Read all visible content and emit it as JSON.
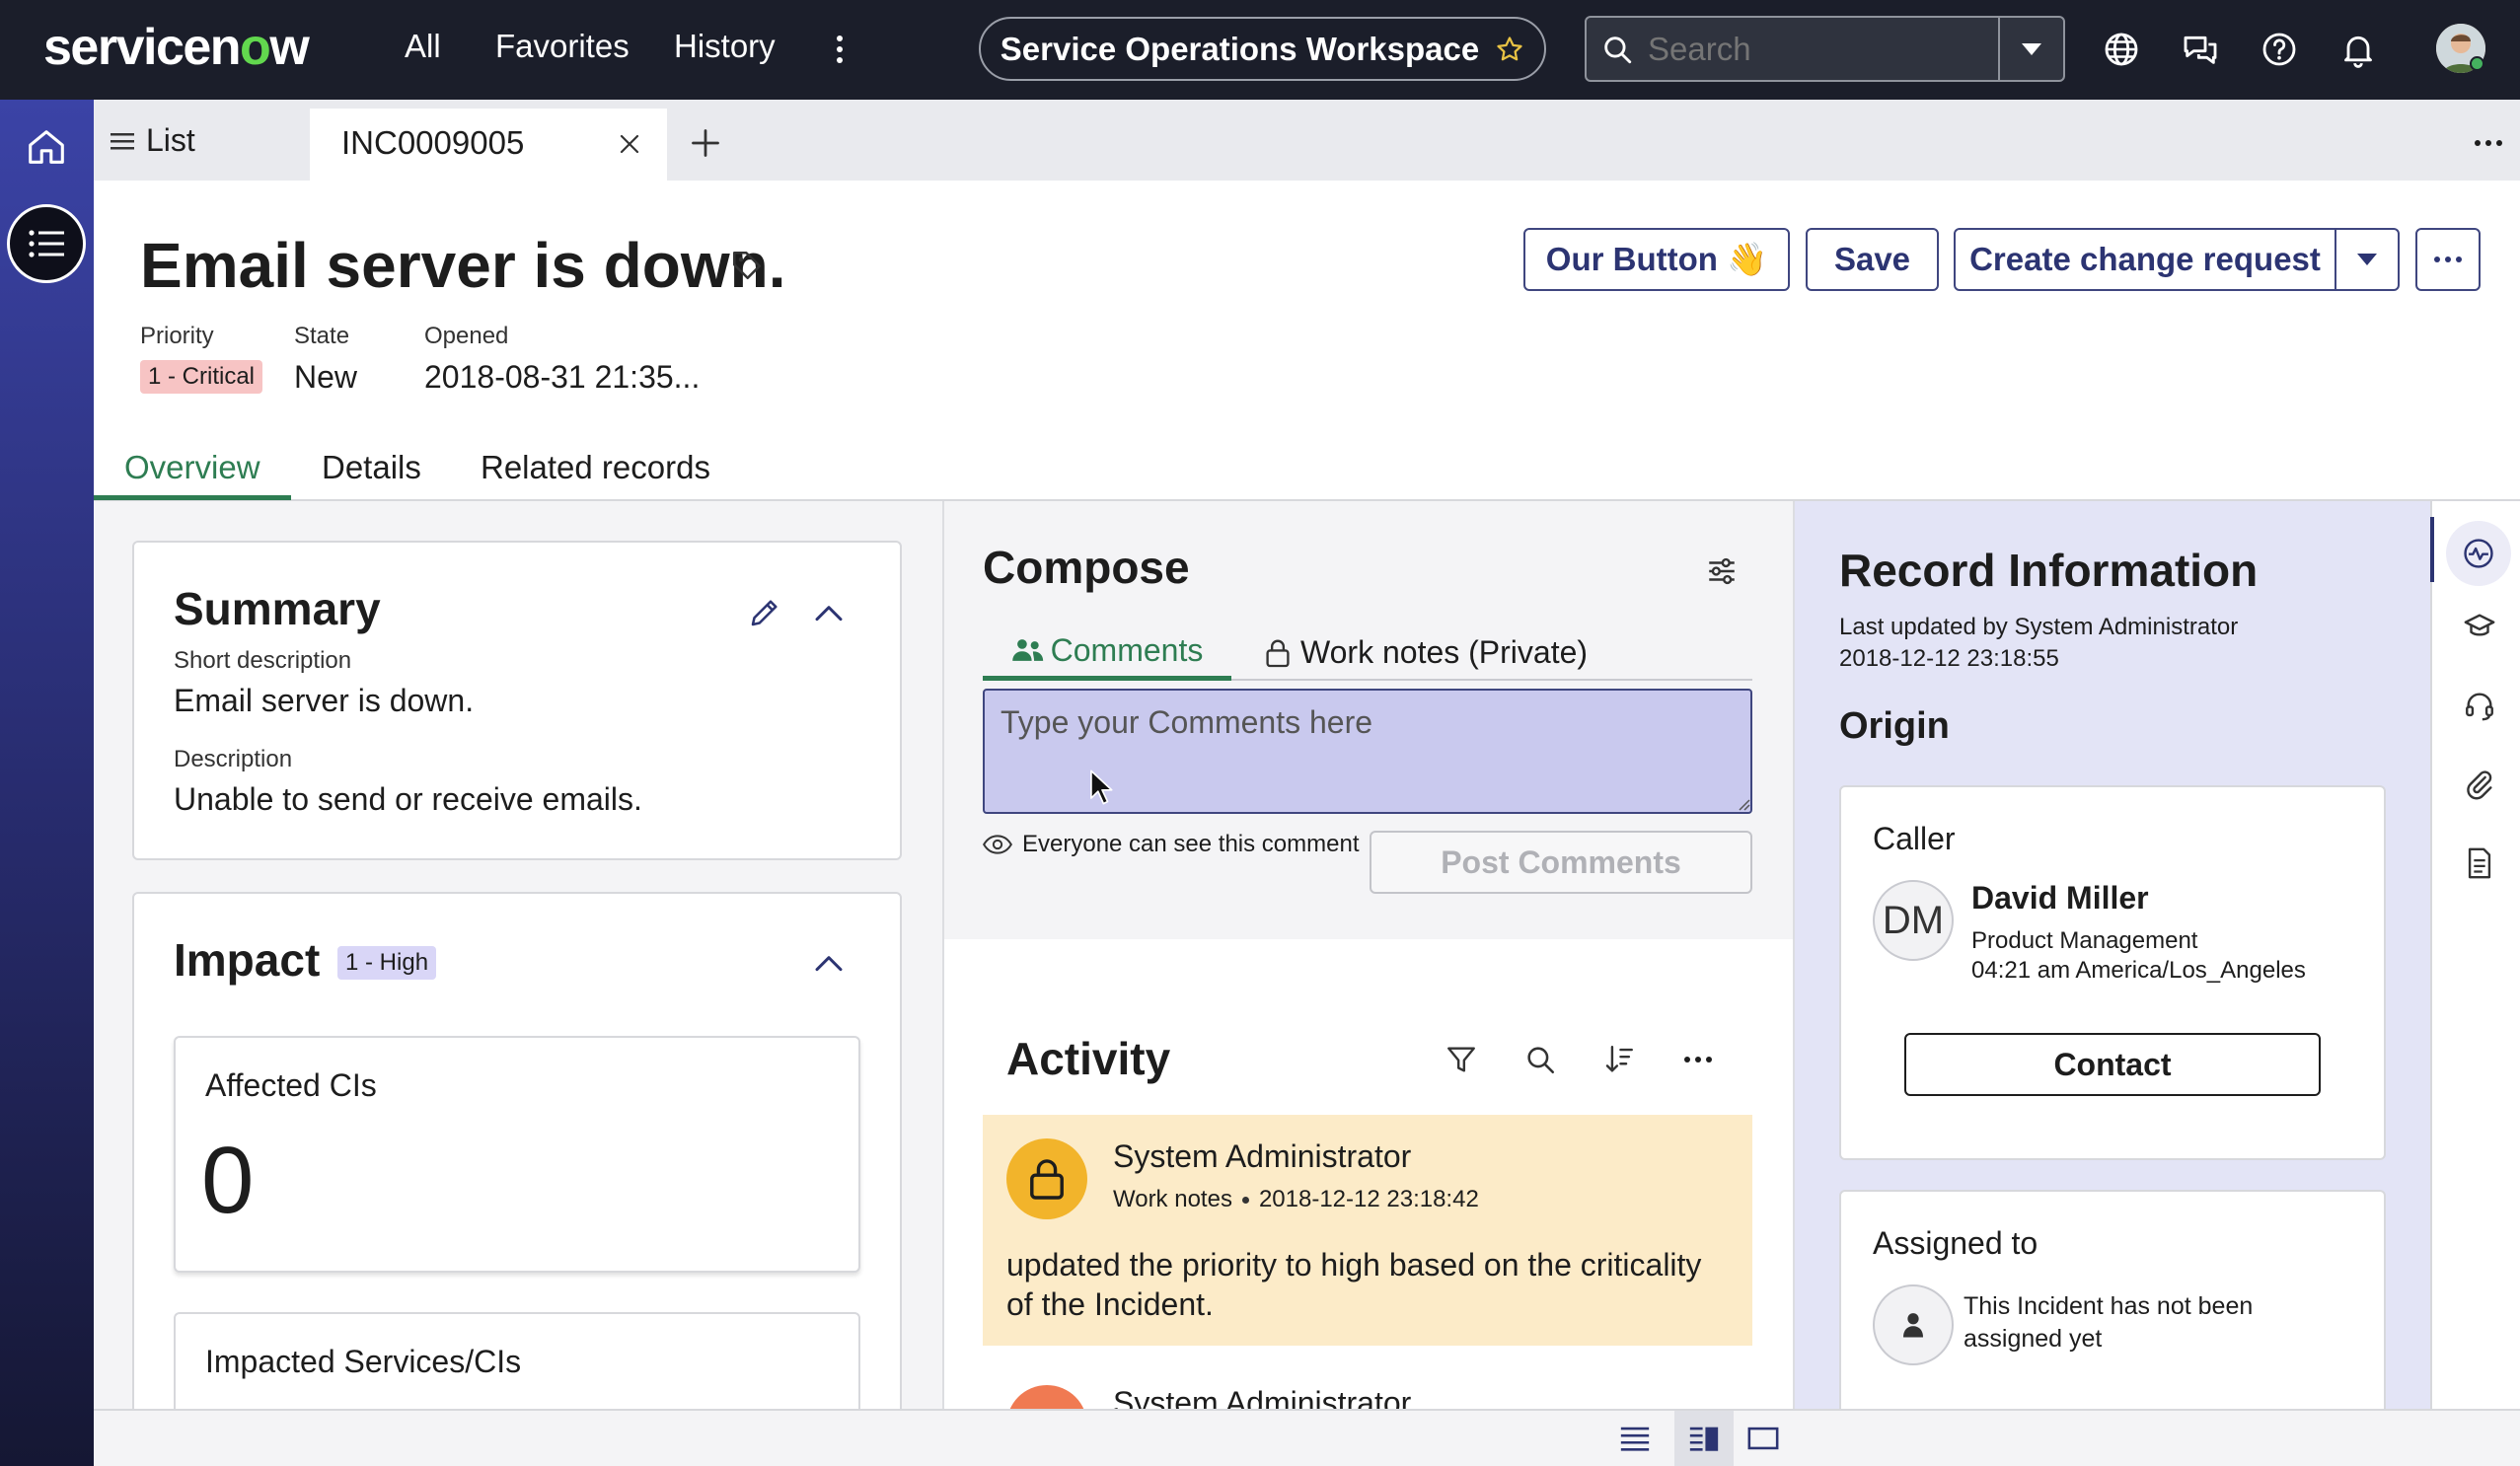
{
  "topbar": {
    "logo_text_a": "servicen",
    "logo_text_o": "o",
    "logo_text_b": "w",
    "nav": [
      "All",
      "Favorites",
      "History"
    ],
    "workspace": "Service Operations Workspace",
    "search_placeholder": "Search"
  },
  "tabs": {
    "list_label": "List",
    "record_label": "INC0009005"
  },
  "record": {
    "title": "Email server is down.",
    "priority_label": "Priority",
    "priority_value": "1 - Critical",
    "state_label": "State",
    "state_value": "New",
    "opened_label": "Opened",
    "opened_value": "2018-08-31 21:35..."
  },
  "header_buttons": {
    "our_button": "Our Button 👋",
    "save": "Save",
    "create_change": "Create change request"
  },
  "record_tabs": [
    "Overview",
    "Details",
    "Related records"
  ],
  "summary": {
    "title": "Summary",
    "short_desc_label": "Short description",
    "short_desc_value": "Email server is down.",
    "desc_label": "Description",
    "desc_value": "Unable to send or receive emails."
  },
  "impact": {
    "title": "Impact",
    "badge": "1 - High",
    "affected_label": "Affected CIs",
    "affected_value": "0",
    "impacted_label": "Impacted Services/CIs"
  },
  "compose": {
    "title": "Compose",
    "tab_comments": "Comments",
    "tab_worknotes": "Work notes (Private)",
    "placeholder": "Type your Comments here",
    "visibility": "Everyone can see this comment",
    "post_button": "Post Comments"
  },
  "activity": {
    "title": "Activity",
    "entries": [
      {
        "author": "System Administrator",
        "type": "Work notes",
        "timestamp": "2018-12-12 23:18:42",
        "text_line1": "updated the priority to high based on the criticality",
        "text_line2": "of the Incident."
      },
      {
        "author": "System Administrator"
      }
    ]
  },
  "record_info": {
    "title": "Record Information",
    "updated_by": "Last updated by System Administrator",
    "updated_at": "2018-12-12 23:18:55",
    "origin_title": "Origin",
    "caller": {
      "label": "Caller",
      "initials": "DM",
      "name": "David Miller",
      "department": "Product Management",
      "local_time": "04:21 am America/Los_Angeles",
      "contact_button": "Contact"
    },
    "assigned": {
      "label": "Assigned to",
      "text_line1": "This Incident has not been",
      "text_line2": "assigned yet"
    }
  },
  "colors": {
    "topbar_bg": "#1b1e2a",
    "accent_green": "#2e7d52",
    "brand_indigo": "#2c3472",
    "priority_badge": "#f7c4c4",
    "impact_badge": "#d9d6f7",
    "activity_bg": "#fcebc8"
  }
}
